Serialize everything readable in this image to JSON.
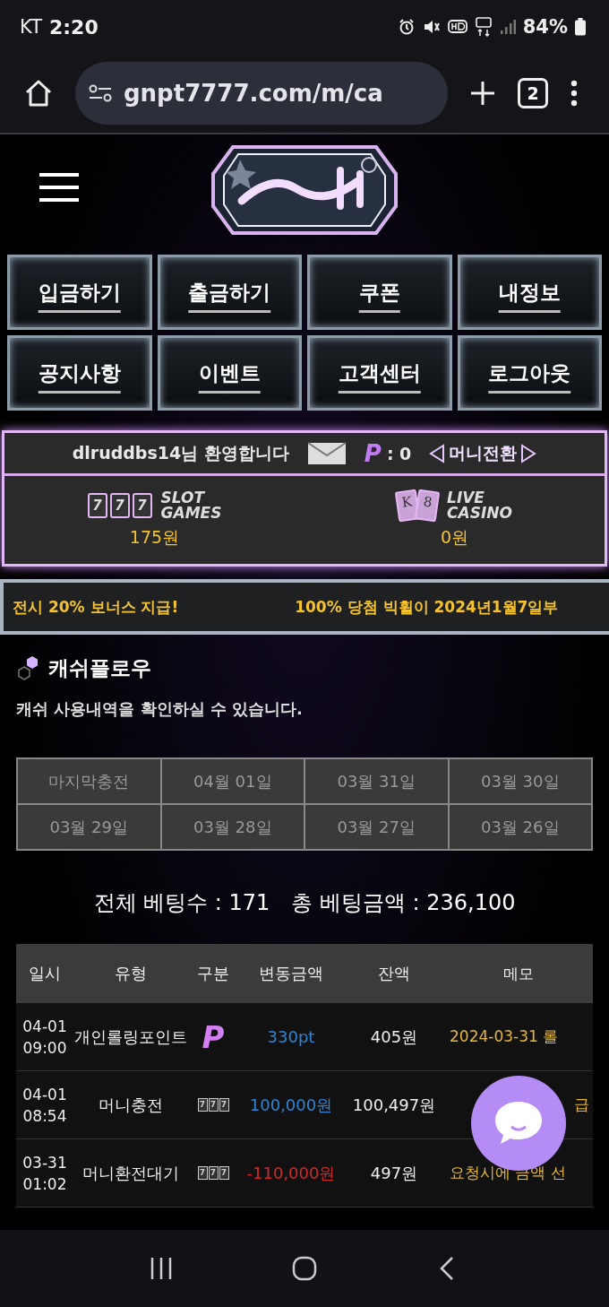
{
  "status_bar": {
    "carrier": "KT",
    "time": "2:20",
    "battery": "84%"
  },
  "browser": {
    "url": "gnpt7777.com/m/ca",
    "tab_count": "2"
  },
  "menu": [
    "입금하기",
    "출금하기",
    "쿠폰",
    "내정보",
    "공지사항",
    "이벤트",
    "고객센터",
    "로그아웃"
  ],
  "user": {
    "welcome": "dlruddbs14님 환영합니다",
    "points_mark": "P",
    "points": ": 0",
    "money_convert": "머니전환"
  },
  "wallets": [
    {
      "kind": "slot",
      "marks": [
        "7",
        "7",
        "7"
      ],
      "title": "SLOT",
      "subtitle": "GAMES",
      "amount": "175원"
    },
    {
      "kind": "casino",
      "marks": [
        "K",
        "8"
      ],
      "title": "LIVE",
      "subtitle": "CASINO",
      "amount": "0원"
    }
  ],
  "ticker": [
    "전시 20% 보너스 지급!",
    "100% 당첨 빅휠이 2024년1월7일부"
  ],
  "section": {
    "title": "캐쉬플로우",
    "description": "캐쉬 사용내역을 확인하실 수 있습니다."
  },
  "date_tabs": [
    "마지막충전",
    "04월 01일",
    "03월 31일",
    "03월 30일",
    "03월 29일",
    "03월 28일",
    "03월 27일",
    "03월 26일"
  ],
  "totals": [
    "전체 베팅수 : 171",
    "총 베팅금액 : 236,100"
  ],
  "table": {
    "columns": [
      "일시",
      "유형",
      "구분",
      "변동금액",
      "잔액",
      "메모"
    ],
    "rows": [
      {
        "date": "04-01",
        "time": "09:00",
        "type": "개인롤링포인트",
        "category": {
          "kind": "point",
          "marks": [
            "P"
          ]
        },
        "amount": "330pt",
        "color": "#2f86d8",
        "balance": "405원",
        "memo": "2024-03-31 롤"
      },
      {
        "date": "04-01",
        "time": "08:54",
        "type": "머니충전",
        "category": {
          "kind": "slot",
          "marks": [
            "7",
            "7",
            "7"
          ]
        },
        "amount": "100,000원",
        "color": "#2f86d8",
        "balance": "100,497원",
        "memo": "급"
      },
      {
        "date": "03-31",
        "time": "01:02",
        "type": "머니환전대기",
        "category": {
          "kind": "slot",
          "marks": [
            "7",
            "7",
            "7"
          ]
        },
        "amount": "-110,000원",
        "color": "#d02b2b",
        "balance": "497원",
        "memo": "요청시에 금액 선"
      }
    ]
  }
}
